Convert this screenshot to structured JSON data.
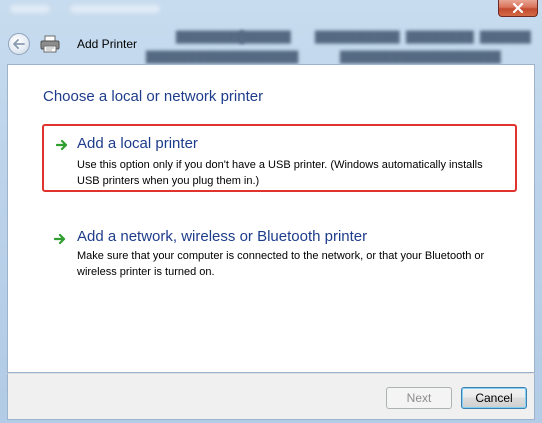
{
  "window": {
    "title": "Add Printer",
    "close_icon": "close-icon"
  },
  "navigation": {
    "back_icon": "back-arrow-icon",
    "printer_icon": "printer-icon"
  },
  "main": {
    "heading": "Choose a local or network printer",
    "options": [
      {
        "title": "Add a local printer",
        "description": "Use this option only if you don't have a USB printer. (Windows automatically installs USB printers when you plug them in.)",
        "icon": "green-arrow-icon",
        "highlighted": true
      },
      {
        "title": "Add a network, wireless or Bluetooth printer",
        "description": "Make sure that your computer is connected to the network, or that your Bluetooth or wireless printer is turned on.",
        "icon": "green-arrow-icon",
        "highlighted": false
      }
    ]
  },
  "buttons": {
    "next_label": "Next",
    "next_enabled": false,
    "cancel_label": "Cancel"
  },
  "colors": {
    "link_blue": "#1e3c8c",
    "highlight_red": "#e0332e",
    "arrow_green": "#2f9e2f"
  }
}
